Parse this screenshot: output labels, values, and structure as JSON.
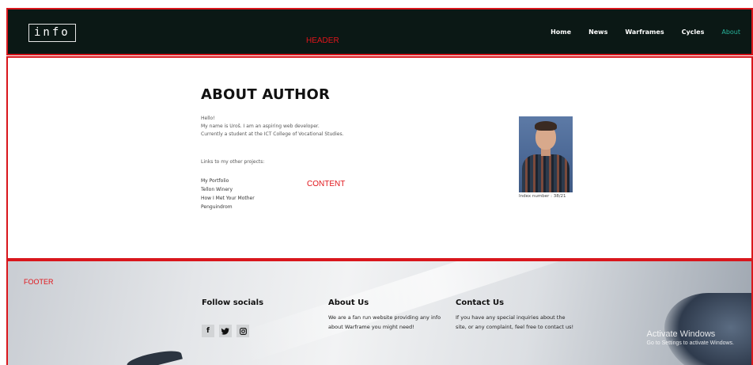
{
  "header": {
    "logo_text": "info",
    "region_label": "HEADER",
    "nav": [
      {
        "label": "Home",
        "active": false
      },
      {
        "label": "News",
        "active": false
      },
      {
        "label": "Warframes",
        "active": false
      },
      {
        "label": "Cycles",
        "active": false
      },
      {
        "label": "About",
        "active": true
      }
    ]
  },
  "content": {
    "region_label": "CONTENT",
    "title": "ABOUT AUTHOR",
    "intro_lines": [
      "Hello!",
      "My name is Uroš. I am an aspiring web developer.",
      "Currently a student at the ICT College of Vocational Studies."
    ],
    "links_heading": "Links to my other projects:",
    "links": [
      "My Portfolio",
      "Tellon Winery",
      "How I Met Your Mother",
      "Penguindrom"
    ],
    "index_number": "Index number : 38/21"
  },
  "footer": {
    "region_label": "FOOTER",
    "socials": {
      "title": "Follow socials",
      "icons": [
        {
          "name": "facebook-icon",
          "glyph": "f"
        },
        {
          "name": "twitter-icon",
          "glyph": "🐦"
        },
        {
          "name": "instagram-icon",
          "glyph": "◙"
        }
      ]
    },
    "about": {
      "title": "About Us",
      "text": "We are a fan run website providing any info about Warframe you might need!"
    },
    "contact": {
      "title": "Contact Us",
      "text": "If you have any special inquiries about the site, or any complaint, feel free to contact us!"
    },
    "watermark": {
      "line1": "Activate Windows",
      "line2": "Go to Settings to activate Windows."
    }
  },
  "colors": {
    "header_bg": "#0b1815",
    "region_border": "#d9161c",
    "active_nav": "#27b39a"
  }
}
